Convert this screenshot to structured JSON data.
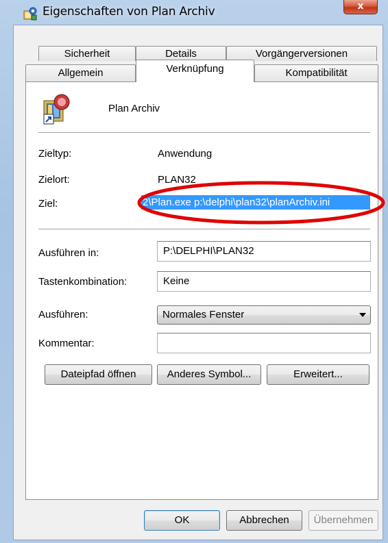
{
  "window": {
    "title": "Eigenschaften von Plan Archiv",
    "close_label": "x"
  },
  "tabs_row1": [
    {
      "label": "Sicherheit"
    },
    {
      "label": "Details"
    },
    {
      "label": "Vorgängerversionen"
    }
  ],
  "tabs_row2": [
    {
      "label": "Allgemein"
    },
    {
      "label": "Verknüpfung",
      "active": true
    },
    {
      "label": "Kompatibilität"
    }
  ],
  "shortcut": {
    "name": "Plan Archiv",
    "icon": "plan-archive-icon"
  },
  "fields": {
    "zieltyp_label": "Zieltyp:",
    "zieltyp_value": "Anwendung",
    "zielort_label": "Zielort:",
    "zielort_value": "PLAN32",
    "ziel_label": "Ziel:",
    "ziel_value": "2\\Plan.exe p:\\delphi\\plan32\\planArchiv.ini",
    "ausfuehren_in_label": "Ausführen in:",
    "ausfuehren_in_value": "P:\\DELPHI\\PLAN32",
    "tastenkombination_label": "Tastenkombination:",
    "tastenkombination_value": "Keine",
    "ausfuehren_label": "Ausführen:",
    "ausfuehren_value": "Normales Fenster",
    "kommentar_label": "Kommentar:",
    "kommentar_value": ""
  },
  "buttons": {
    "dateipfad": "Dateipfad öffnen",
    "symbol": "Anderes Symbol...",
    "erweitert": "Erweitert...",
    "ok": "OK",
    "abbrechen": "Abbrechen",
    "uebernehmen": "Übernehmen"
  },
  "colors": {
    "selection": "#3399ff",
    "annotation": "#e00000",
    "close_button": "#c7442a"
  }
}
